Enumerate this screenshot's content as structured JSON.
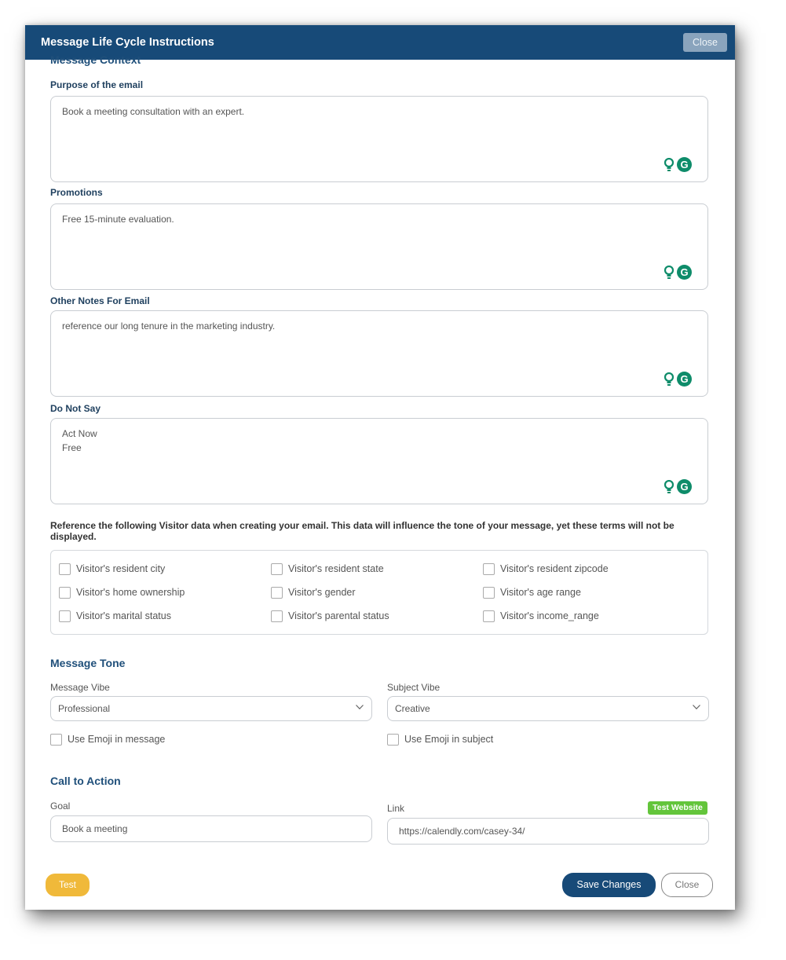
{
  "modal": {
    "title": "Message Life Cycle Instructions",
    "header_close_label": "Close"
  },
  "message_context": {
    "section_title": "Message Context",
    "fields": [
      {
        "label": "Purpose of the email",
        "value": "Book a meeting consultation with an expert."
      },
      {
        "label": "Promotions",
        "value": "Free 15-minute evaluation."
      },
      {
        "label": "Other Notes For Email",
        "value": "reference our long tenure in the marketing industry."
      },
      {
        "label": "Do Not Say",
        "value": "Act Now\nFree"
      }
    ],
    "icons": {
      "bulb": "lightbulb-icon",
      "grammarly": "grammarly-icon",
      "grammarly_glyph": "G"
    }
  },
  "visitor_data": {
    "note": "Reference the following Visitor data when creating your email. This data will influence the tone of your message, yet these terms will not be displayed.",
    "options": [
      "Visitor's resident city",
      "Visitor's resident state",
      "Visitor's resident zipcode",
      "Visitor's home ownership",
      "Visitor's gender",
      "Visitor's age range",
      "Visitor's marital status",
      "Visitor's parental status",
      "Visitor's income_range"
    ]
  },
  "message_tone": {
    "section_title": "Message Tone",
    "message_vibe_label": "Message Vibe",
    "message_vibe_value": "Professional",
    "subject_vibe_label": "Subject Vibe",
    "subject_vibe_value": "Creative",
    "emoji_message_label": "Use Emoji in message",
    "emoji_subject_label": "Use Emoji in subject"
  },
  "call_to_action": {
    "section_title": "Call to Action",
    "goal_label": "Goal",
    "goal_value": "Book a meeting",
    "link_label": "Link",
    "link_value": "https://calendly.com/casey-34/",
    "test_website_label": "Test Website"
  },
  "footer": {
    "test_label": "Test",
    "save_label": "Save Changes",
    "close_label": "Close"
  },
  "colors": {
    "header": "#174a78",
    "save_button": "#174a78",
    "test_button": "#f0b93a",
    "badge": "#63c53b",
    "grammarly": "#0e8c6a"
  }
}
